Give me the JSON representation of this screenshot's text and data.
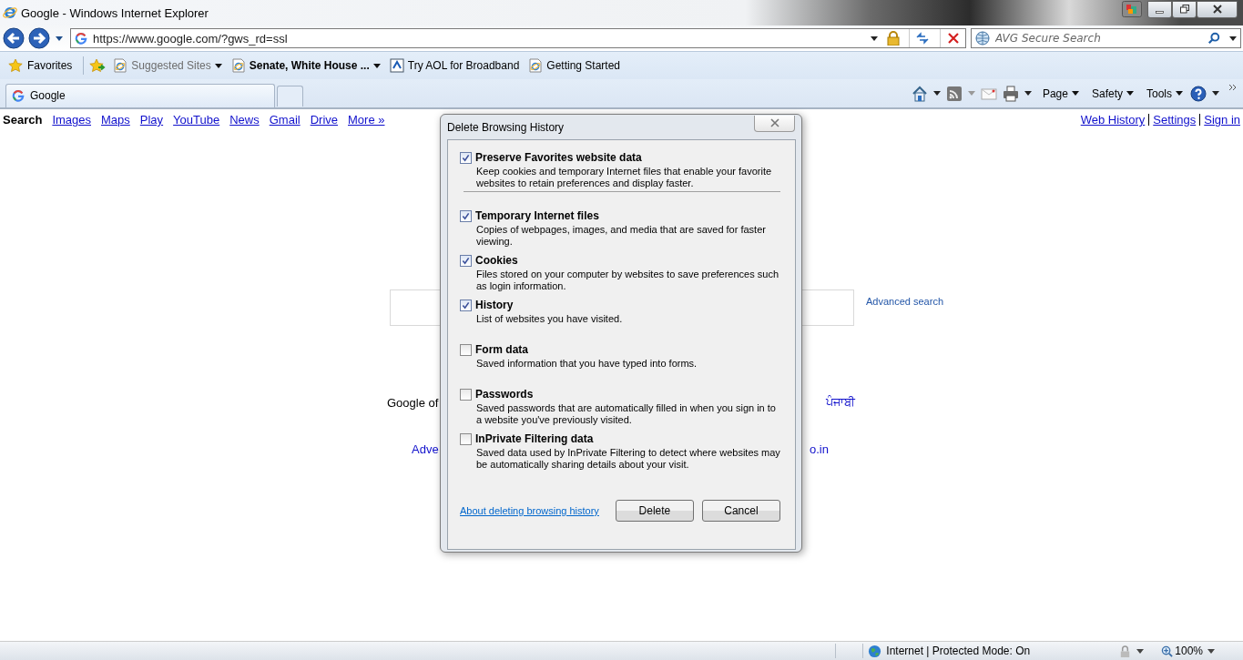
{
  "window": {
    "title": "Google - Windows Internet Explorer"
  },
  "address_bar": {
    "url": "https://www.google.com/?gws_rd=ssl"
  },
  "search_box": {
    "placeholder": "AVG Secure Search"
  },
  "favorites_bar": {
    "label": "Favorites",
    "items": [
      {
        "label": "Suggested Sites",
        "kind": "suggested"
      },
      {
        "label": "Senate, White House ...",
        "kind": "slice"
      },
      {
        "label": "Try AOL for Broadband",
        "kind": "aol"
      },
      {
        "label": "Getting Started",
        "kind": "link"
      }
    ]
  },
  "tabs": [
    {
      "label": "Google",
      "selected": true
    }
  ],
  "command_bar": {
    "menus": [
      "Page",
      "Safety",
      "Tools"
    ]
  },
  "google_nav": {
    "links": [
      {
        "label": "Search",
        "selected": true
      },
      {
        "label": "Images",
        "selected": false
      },
      {
        "label": "Maps",
        "selected": false
      },
      {
        "label": "Play",
        "selected": false
      },
      {
        "label": "YouTube",
        "selected": false
      },
      {
        "label": "News",
        "selected": false
      },
      {
        "label": "Gmail",
        "selected": false
      },
      {
        "label": "Drive",
        "selected": false
      },
      {
        "label": "More »",
        "selected": false
      }
    ],
    "account_links": [
      "Web History",
      "Settings",
      "Sign in"
    ]
  },
  "google_body": {
    "advanced_search": "Advanced search",
    "offered_in_start": "Google of",
    "offered_in_end": "ਪੰਜਾਬੀ",
    "footer_start": "Adve",
    "footer_end": "o.in"
  },
  "dialog": {
    "title": "Delete Browsing History",
    "options": [
      {
        "label": "Preserve Favorites website data",
        "description": "Keep cookies and temporary Internet files that enable your favorite websites to retain preferences and display faster.",
        "checked": true,
        "kind": "preserve"
      },
      {
        "label": "Temporary Internet files",
        "description": "Copies of webpages, images, and media that are saved for faster viewing.",
        "checked": true,
        "kind": "category"
      },
      {
        "label": "Cookies",
        "description": "Files stored on your computer by websites to save preferences such as login information.",
        "checked": true,
        "kind": "category"
      },
      {
        "label": "History",
        "description": "List of websites you have visited.",
        "checked": true,
        "kind": "category"
      },
      {
        "label": "Form data",
        "description": "Saved information that you have typed into forms.",
        "checked": false,
        "kind": "category"
      },
      {
        "label": "Passwords",
        "description": "Saved passwords that are automatically filled in when you sign in to a website you've previously visited.",
        "checked": false,
        "kind": "category"
      },
      {
        "label": "InPrivate Filtering data",
        "description": "Saved data used by InPrivate Filtering to detect where websites may be automatically sharing details about your visit.",
        "checked": false,
        "kind": "category"
      }
    ],
    "help_link": "About deleting browsing history",
    "buttons": [
      "Delete",
      "Cancel"
    ]
  },
  "status_bar": {
    "zone": "Internet | Protected Mode: On",
    "zoom": "100%"
  }
}
